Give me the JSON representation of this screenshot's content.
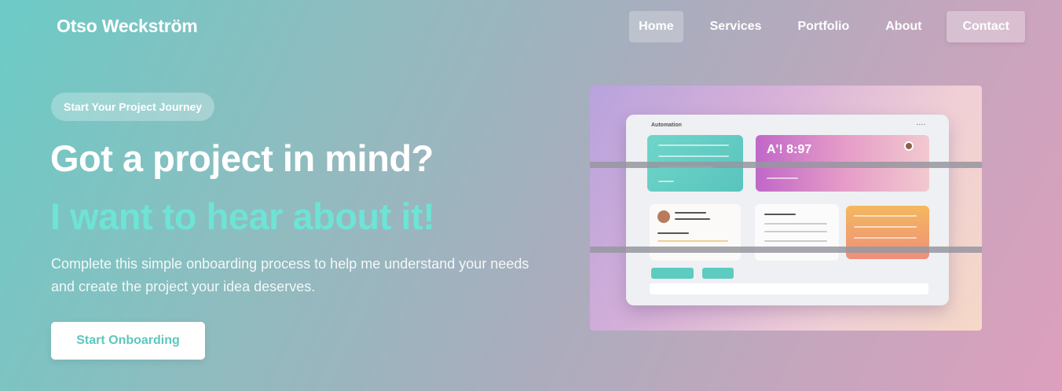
{
  "brand": "Otso Weckström",
  "nav": {
    "home": "Home",
    "services": "Services",
    "portfolio": "Portfolio",
    "about": "About",
    "contact": "Contact"
  },
  "hero": {
    "badge": "Start Your Project Journey",
    "heading": "Got a project in mind?",
    "subheading": "I want to hear about it!",
    "description": "Complete this simple onboarding process to help me understand your needs and create the project your idea deserves.",
    "cta": "Start Onboarding"
  },
  "mockup": {
    "title": "Automation",
    "clock": "A'! 8:97"
  },
  "colors": {
    "accent": "#6ee3d6",
    "cta_text": "#5cc7bd"
  }
}
